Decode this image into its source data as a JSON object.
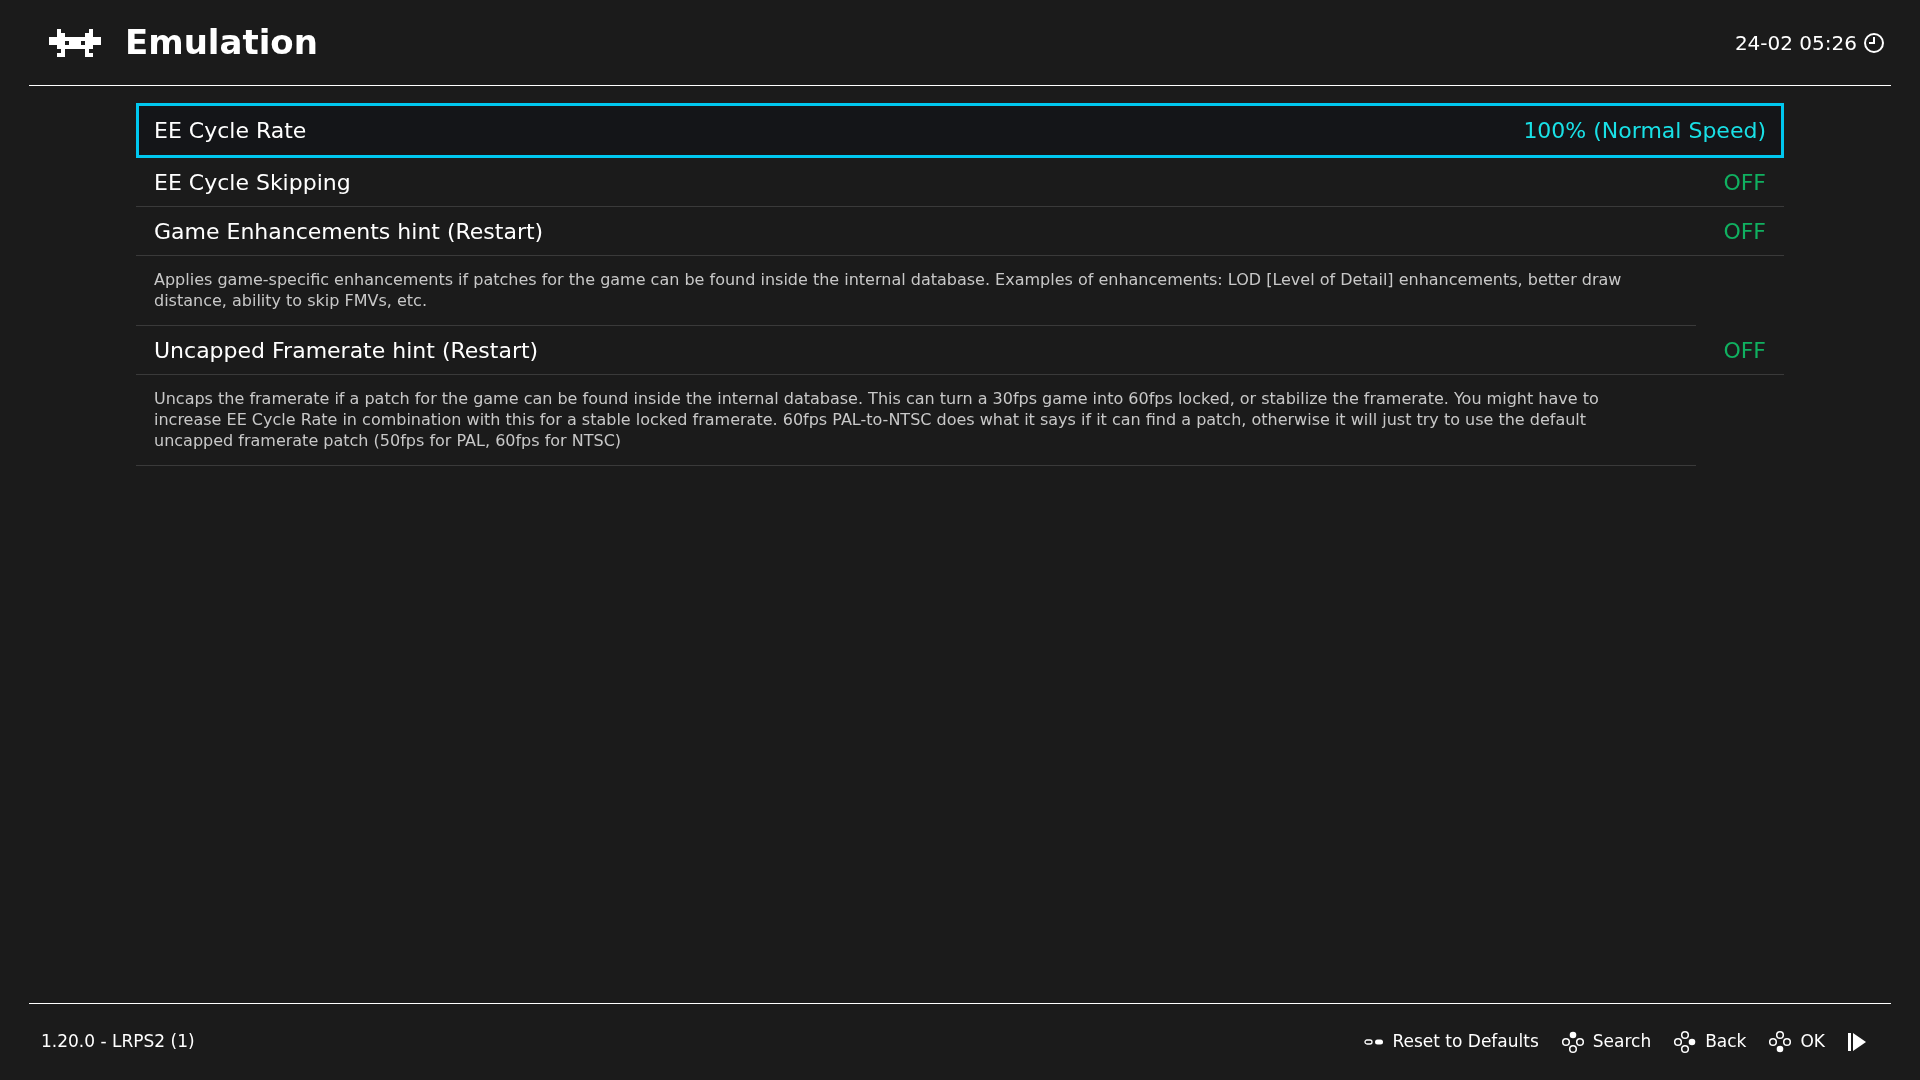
{
  "header": {
    "title": "Emulation",
    "clock": "24-02 05:26"
  },
  "settings": [
    {
      "label": "EE Cycle Rate",
      "value": "100% (Normal Speed)",
      "selected": true
    },
    {
      "label": "EE Cycle Skipping",
      "value": "OFF",
      "selected": false
    },
    {
      "label": "Game Enhancements hint (Restart)",
      "value": "OFF",
      "selected": false,
      "description": "Applies game-specific enhancements if patches for the game can be found inside the internal database. Examples of enhancements: LOD [Level of Detail] enhancements, better draw distance, ability to skip FMVs, etc."
    },
    {
      "label": "Uncapped Framerate hint (Restart)",
      "value": "OFF",
      "selected": false,
      "description": "Uncaps the framerate if a patch for the game can be found inside the internal database. This can turn a 30fps game into 60fps locked, or stabilize the framerate. You might have to increase EE Cycle Rate in combination with this for a stable locked framerate. 60fps PAL-to-NTSC does what it says if it can find a patch, otherwise it will just try to use the default uncapped framerate patch (50fps for PAL, 60fps for NTSC)"
    }
  ],
  "footer": {
    "version": "1.20.0 - LRPS2 (1)",
    "actions": [
      {
        "kind": "select",
        "label": "Reset to Defaults"
      },
      {
        "kind": "top",
        "label": "Search"
      },
      {
        "kind": "right",
        "label": "Back"
      },
      {
        "kind": "bottom",
        "label": "OK"
      },
      {
        "kind": "start"
      }
    ]
  }
}
